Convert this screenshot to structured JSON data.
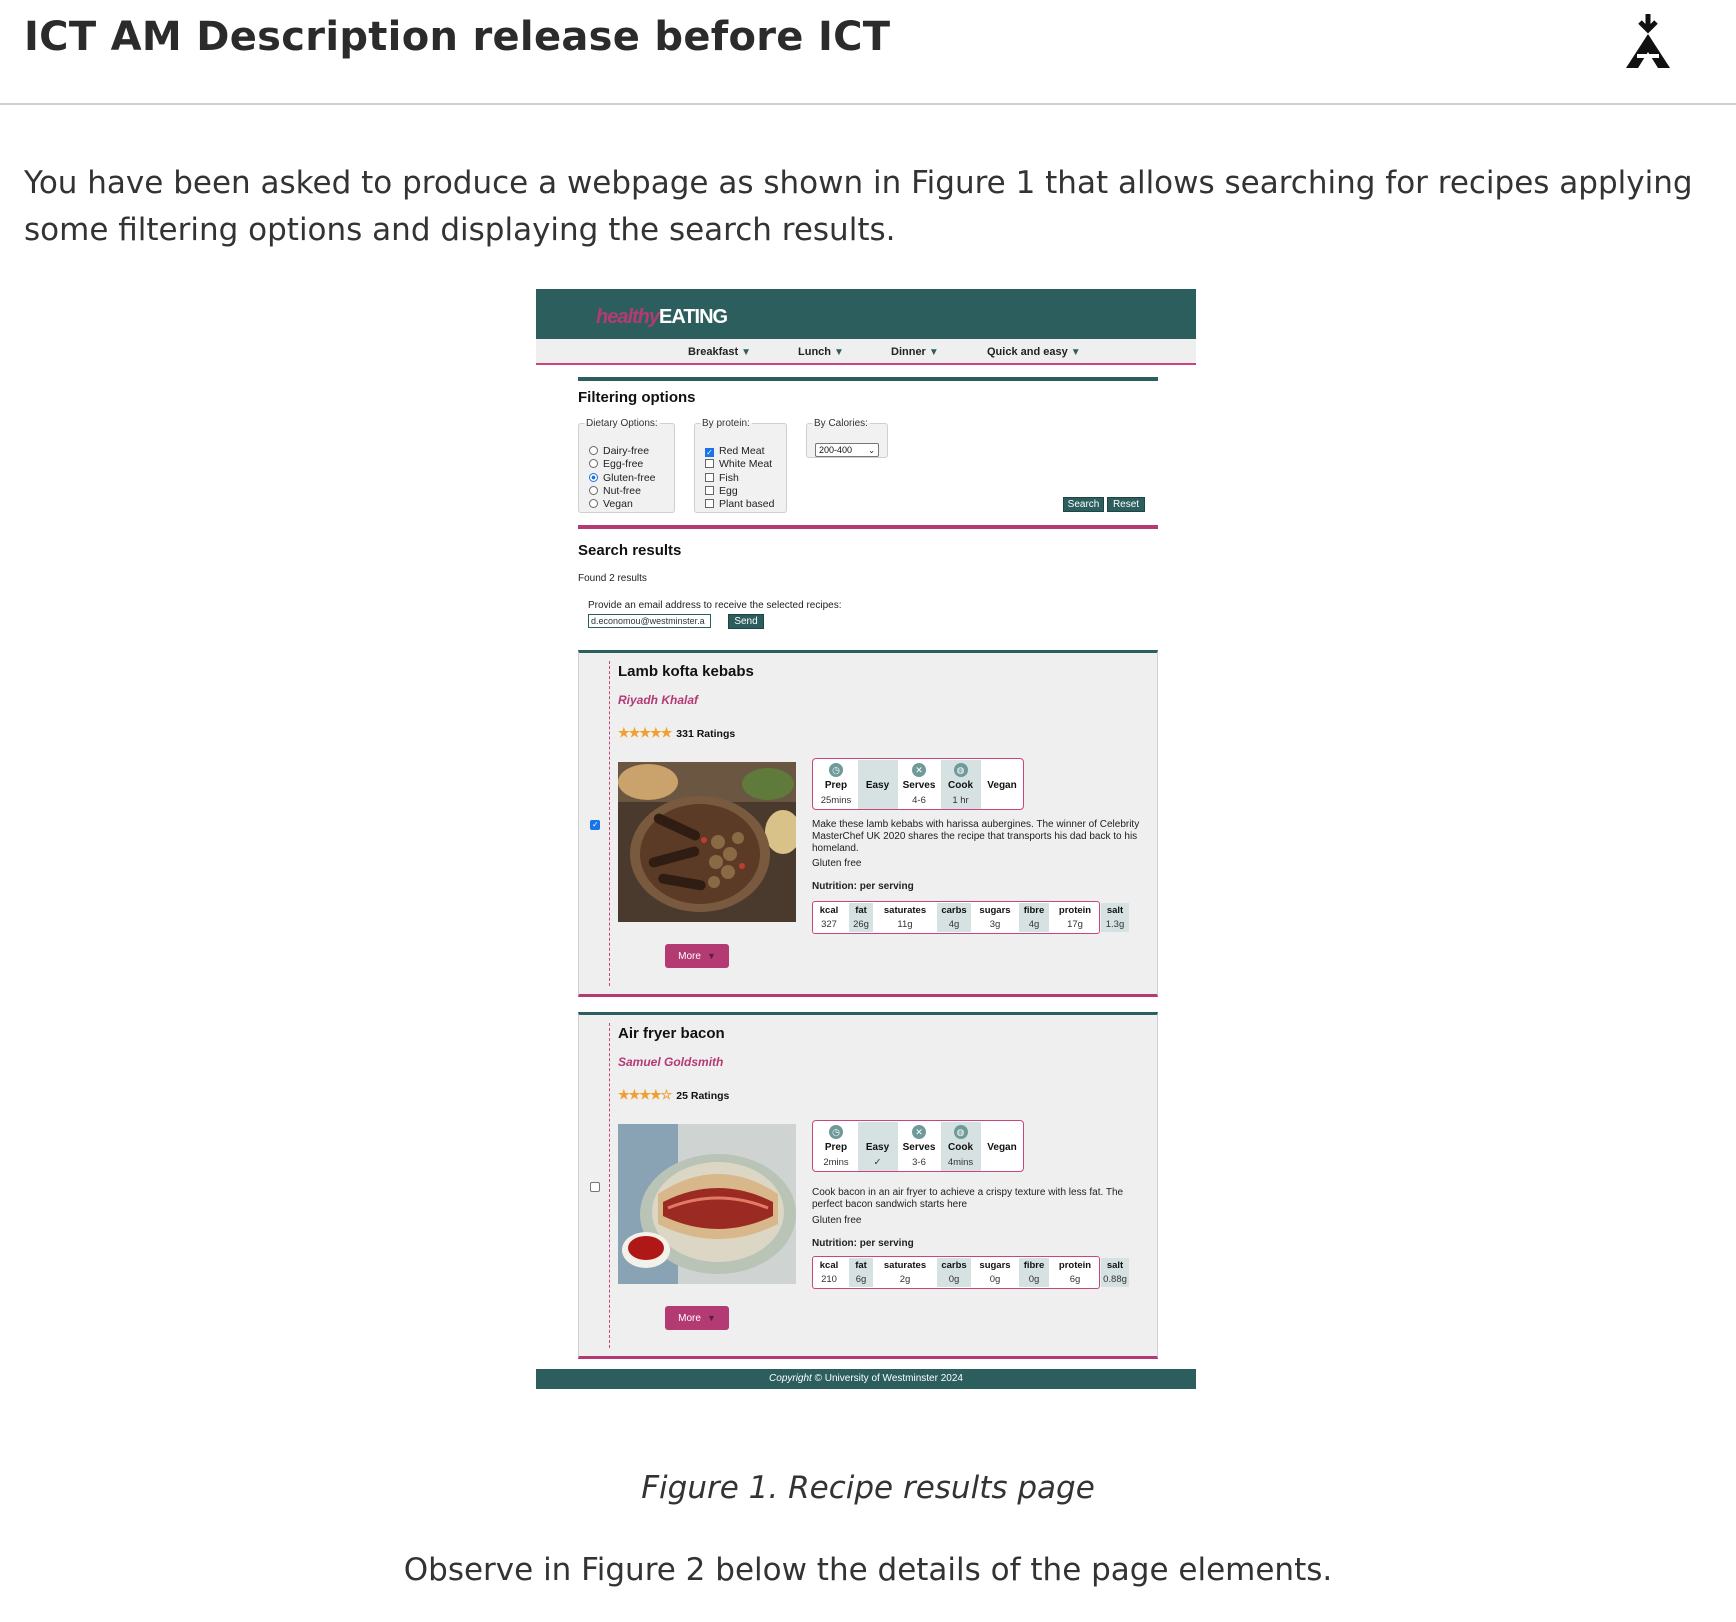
{
  "page": {
    "title": "ICT AM Description release before ICT",
    "intro": "You have been asked to produce a webpage as shown in Figure 1 that allows searching for recipes applying some filtering options and displaying the search results.",
    "logo_icon": "stacked-triangle-download-icon",
    "caption": "Figure 1. Recipe results page",
    "observe": "Observe in Figure 2 below the details of the page elements."
  },
  "figure": {
    "brand_part1": "healthy",
    "brand_part2": "EATING",
    "nav": [
      "Breakfast",
      "Lunch",
      "Dinner",
      "Quick and easy"
    ],
    "filtering_title": "Filtering options",
    "dietary_legend": "Dietary Options:",
    "dietary_options": [
      "Dairy-free",
      "Egg-free",
      "Gluten-free",
      "Nut-free",
      "Vegan"
    ],
    "dietary_selected": "Gluten-free",
    "protein_legend": "By protein:",
    "protein_options": [
      "Red Meat",
      "White Meat",
      "Fish",
      "Egg",
      "Plant based"
    ],
    "protein_checked": [
      "Red Meat"
    ],
    "calories_legend": "By Calories:",
    "calories_value": "200-400",
    "search_label": "Search",
    "reset_label": "Reset",
    "results_title": "Search results",
    "found_text": "Found 2 results",
    "email_prompt": "Provide an email address to receive the selected recipes:",
    "email_value": "d.economou@westminster.a",
    "send_label": "Send",
    "footer_italic": "Copyright",
    "footer_rest": " © University of Westminster 2024",
    "colors": {
      "teal": "#2c5e5e",
      "magenta": "#b43a74",
      "star": "#f0a030"
    }
  },
  "recipes": [
    {
      "title": "Lamb kofta kebabs",
      "author": "Riyadh Khalaf",
      "stars": "★★★★★",
      "ratings": "331 Ratings",
      "selected": true,
      "info": [
        {
          "icon": "clock-icon",
          "label": "Prep",
          "value": "25mins"
        },
        {
          "icon": "",
          "label": "Easy",
          "value": ""
        },
        {
          "icon": "cutlery-icon",
          "label": "Serves",
          "value": "4-6"
        },
        {
          "icon": "pot-icon",
          "label": "Cook",
          "value": "1 hr"
        },
        {
          "icon": "",
          "label": "Vegan",
          "value": ""
        }
      ],
      "description": "Make these lamb kebabs with harissa aubergines. The winner of Celebrity MasterChef UK 2020 shares the recipe that transports his dad back to his homeland.",
      "diet": "Gluten free",
      "nutrition_title": "Nutrition: per serving",
      "nutrition": [
        {
          "label": "kcal",
          "value": "327"
        },
        {
          "label": "fat",
          "value": "26g"
        },
        {
          "label": "saturates",
          "value": "11g"
        },
        {
          "label": "carbs",
          "value": "4g"
        },
        {
          "label": "sugars",
          "value": "3g"
        },
        {
          "label": "fibre",
          "value": "4g"
        },
        {
          "label": "protein",
          "value": "17g"
        },
        {
          "label": "salt",
          "value": "1.3g"
        }
      ],
      "more_label": "More"
    },
    {
      "title": "Air fryer bacon",
      "author": "Samuel Goldsmith",
      "stars": "★★★★☆",
      "ratings": "25 Ratings",
      "selected": false,
      "info": [
        {
          "icon": "clock-icon",
          "label": "Prep",
          "value": "2mins"
        },
        {
          "icon": "",
          "label": "Easy",
          "value": "✓"
        },
        {
          "icon": "cutlery-icon",
          "label": "Serves",
          "value": "3-6"
        },
        {
          "icon": "pot-icon",
          "label": "Cook",
          "value": "4mins"
        },
        {
          "icon": "",
          "label": "Vegan",
          "value": ""
        }
      ],
      "description": "Cook bacon in an air fryer to achieve a crispy texture with less fat. The perfect bacon sandwich starts here",
      "diet": "Gluten free",
      "nutrition_title": "Nutrition: per serving",
      "nutrition": [
        {
          "label": "kcal",
          "value": "210"
        },
        {
          "label": "fat",
          "value": "6g"
        },
        {
          "label": "saturates",
          "value": "2g"
        },
        {
          "label": "carbs",
          "value": "0g"
        },
        {
          "label": "sugars",
          "value": "0g"
        },
        {
          "label": "fibre",
          "value": "0g"
        },
        {
          "label": "protein",
          "value": "6g"
        },
        {
          "label": "salt",
          "value": "0.88g"
        }
      ],
      "more_label": "More"
    }
  ]
}
